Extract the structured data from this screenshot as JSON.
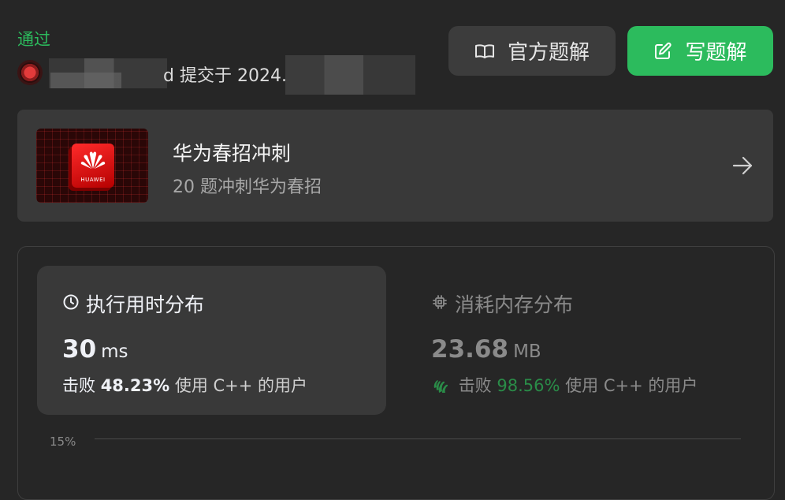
{
  "submission": {
    "status": "通过",
    "author_tail": "d",
    "submitted_text": "提交于 2024."
  },
  "actions": {
    "official_solution_label": "官方题解",
    "write_solution_label": "写题解"
  },
  "promo": {
    "title": "华为春招冲刺",
    "subtitle": "20 题冲刺华为春招",
    "image_text": "HUAWEI"
  },
  "runtime": {
    "title": "执行用时分布",
    "value": "30",
    "unit": "ms",
    "beat_prefix": "击败",
    "beat_pct": "48.23%",
    "beat_suffix": "使用 C++ 的用户"
  },
  "memory": {
    "title": "消耗内存分布",
    "value": "23.68",
    "unit": "MB",
    "beat_prefix": "击败",
    "beat_pct": "98.56%",
    "beat_suffix": "使用 C++ 的用户"
  },
  "chart": {
    "y_tick": "15%"
  },
  "colors": {
    "accent_green": "#2cbb5d",
    "background": "#262626",
    "card": "#393939"
  }
}
